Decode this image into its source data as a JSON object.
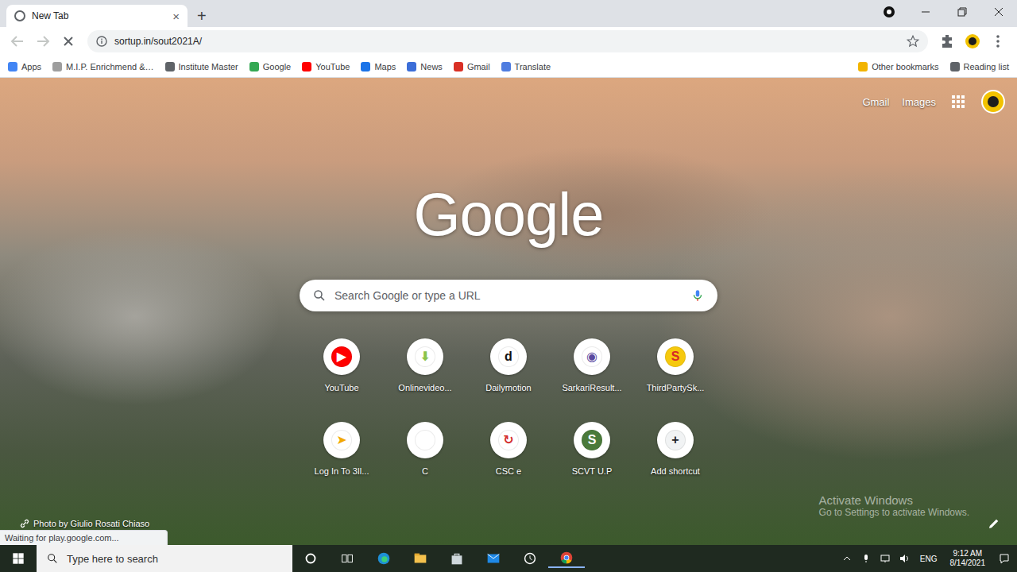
{
  "browser": {
    "tabs": [
      {
        "title": "New Tab",
        "selected": true,
        "close": "×"
      }
    ],
    "new_tab": "+",
    "address": "sortup.in/sout2021A/",
    "loading": true,
    "back_enabled": false,
    "forward_enabled": false,
    "bookmarks": [
      {
        "label": "Apps",
        "color": "#4285f4"
      },
      {
        "label": "M.I.P. Enrichmend &…",
        "color": "#9e9e9e"
      },
      {
        "label": "Institute Master",
        "color": "#5f6368"
      },
      {
        "label": "Google",
        "color": "#34a853"
      },
      {
        "label": "YouTube",
        "color": "#ff0000"
      },
      {
        "label": "Maps",
        "color": "#1a73e8"
      },
      {
        "label": "News",
        "color": "#3c6ed8"
      },
      {
        "label": "Gmail",
        "color": "#d93025"
      },
      {
        "label": "Translate",
        "color": "#4f7de0"
      }
    ],
    "bookmarks_right": [
      {
        "label": "Other bookmarks",
        "color": "#f2b400"
      },
      {
        "label": "Reading list",
        "color": "#5f6368"
      }
    ]
  },
  "page": {
    "top_links": [
      "Gmail",
      "Images"
    ],
    "logo": "Google",
    "search_placeholder": "Search Google or type a URL",
    "shortcuts": [
      {
        "label": "YouTube",
        "glyph": "▶",
        "color": "#ffffff",
        "fill": "#ff0000"
      },
      {
        "label": "Onlinevideo...",
        "glyph": "⬇",
        "color": "#8bc34a",
        "fill": "#ffffff"
      },
      {
        "label": "Dailymotion",
        "glyph": "d",
        "color": "#111111",
        "fill": "#ffffff"
      },
      {
        "label": "SarkariResult...",
        "glyph": "◉",
        "color": "#5b4aa0",
        "fill": "#ffffff"
      },
      {
        "label": "ThirdPartySk...",
        "glyph": "S",
        "color": "#d62828",
        "fill": "#f6c90e"
      },
      {
        "label": "Log In To 3Il...",
        "glyph": "➤",
        "color": "#f2a900",
        "fill": "#ffffff"
      },
      {
        "label": "C",
        "glyph": "",
        "color": "#e07030",
        "fill": "#ffffff"
      },
      {
        "label": "CSC e",
        "glyph": "↻",
        "color": "#d32f2f",
        "fill": "#ffffff"
      },
      {
        "label": "SCVT U.P",
        "glyph": "S",
        "color": "#ffffff",
        "fill": "#4a7a3a"
      },
      {
        "label": "Add shortcut",
        "glyph": "+",
        "color": "#202124",
        "fill": "#f1f3f4"
      }
    ],
    "photo_credit": "Photo by Giulio Rosati Chiaso"
  },
  "status_bubble": "Waiting for play.google.com...",
  "watermark": {
    "title": "Activate Windows",
    "subtitle": "Go to Settings to activate Windows."
  },
  "taskbar": {
    "search_placeholder": "Type here to search",
    "language": "ENG",
    "time": "9:12 AM",
    "date": "8/14/2021"
  }
}
